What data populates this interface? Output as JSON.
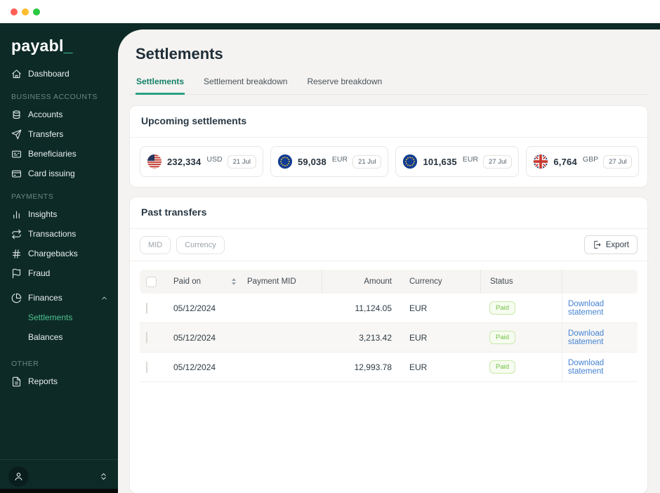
{
  "sidebar": {
    "logo_text": "payabl",
    "logo_accent": "_",
    "groups": [
      {
        "label": "",
        "items": [
          {
            "label": "Dashboard",
            "icon": "home-icon"
          }
        ]
      },
      {
        "label": "BUSINESS ACCOUNTS",
        "items": [
          {
            "label": "Accounts",
            "icon": "coins-icon"
          },
          {
            "label": "Transfers",
            "icon": "send-icon"
          },
          {
            "label": "Beneficiaries",
            "icon": "id-card-icon"
          },
          {
            "label": "Card issuing",
            "icon": "credit-card-icon"
          }
        ]
      },
      {
        "label": "PAYMENTS",
        "items": [
          {
            "label": "Insights",
            "icon": "bar-chart-icon"
          },
          {
            "label": "Transactions",
            "icon": "repeat-icon"
          },
          {
            "label": "Chargebacks",
            "icon": "hash-icon"
          },
          {
            "label": "Fraud",
            "icon": "flag-icon"
          },
          {
            "label": "Finances",
            "icon": "pie-chart-icon",
            "expanded": true,
            "children": [
              {
                "label": "Settlements",
                "active": true
              },
              {
                "label": "Balances",
                "active": false
              }
            ]
          }
        ]
      },
      {
        "label": "OTHER",
        "items": [
          {
            "label": "Reports",
            "icon": "file-icon"
          }
        ]
      }
    ]
  },
  "header": {
    "title": "Settlements"
  },
  "tabs": [
    {
      "label": "Settlements",
      "active": true
    },
    {
      "label": "Settlement breakdown",
      "active": false
    },
    {
      "label": "Reserve breakdown",
      "active": false
    }
  ],
  "upcoming": {
    "title": "Upcoming settlements",
    "cards": [
      {
        "flag": "us-flag-icon",
        "amount": "232,334",
        "currency": "USD",
        "date": "21 Jul"
      },
      {
        "flag": "eu-flag-icon",
        "amount": "59,038",
        "currency": "EUR",
        "date": "21 Jul"
      },
      {
        "flag": "eu-flag-icon",
        "amount": "101,635",
        "currency": "EUR",
        "date": "27 Jul"
      },
      {
        "flag": "gb-flag-icon",
        "amount": "6,764",
        "currency": "GBP",
        "date": "27 Jul"
      }
    ]
  },
  "past": {
    "title": "Past transfers",
    "filters": [
      {
        "label": "MID"
      },
      {
        "label": "Currency"
      }
    ],
    "export_label": "Export",
    "table": {
      "columns": [
        "Paid on",
        "Payment MID",
        "Amount",
        "Currency",
        "Status"
      ],
      "rows": [
        {
          "paid_on": "05/12/2024",
          "amount": "11,124.05",
          "currency": "EUR",
          "status": "Paid",
          "action": "Download statement"
        },
        {
          "paid_on": "05/12/2024",
          "amount": "3,213.42",
          "currency": "EUR",
          "status": "Paid",
          "action": "Download statement"
        },
        {
          "paid_on": "05/12/2024",
          "amount": "12,993.78",
          "currency": "EUR",
          "status": "Paid",
          "action": "Download statement"
        }
      ]
    }
  },
  "colors": {
    "sidebar_bg": "#0d2a27",
    "accent_mint": "#48d597",
    "sidebar_active": "#4fc08d",
    "tab_active": "#15806a",
    "link_blue": "#4583d3",
    "paid_green": "#74c044"
  }
}
